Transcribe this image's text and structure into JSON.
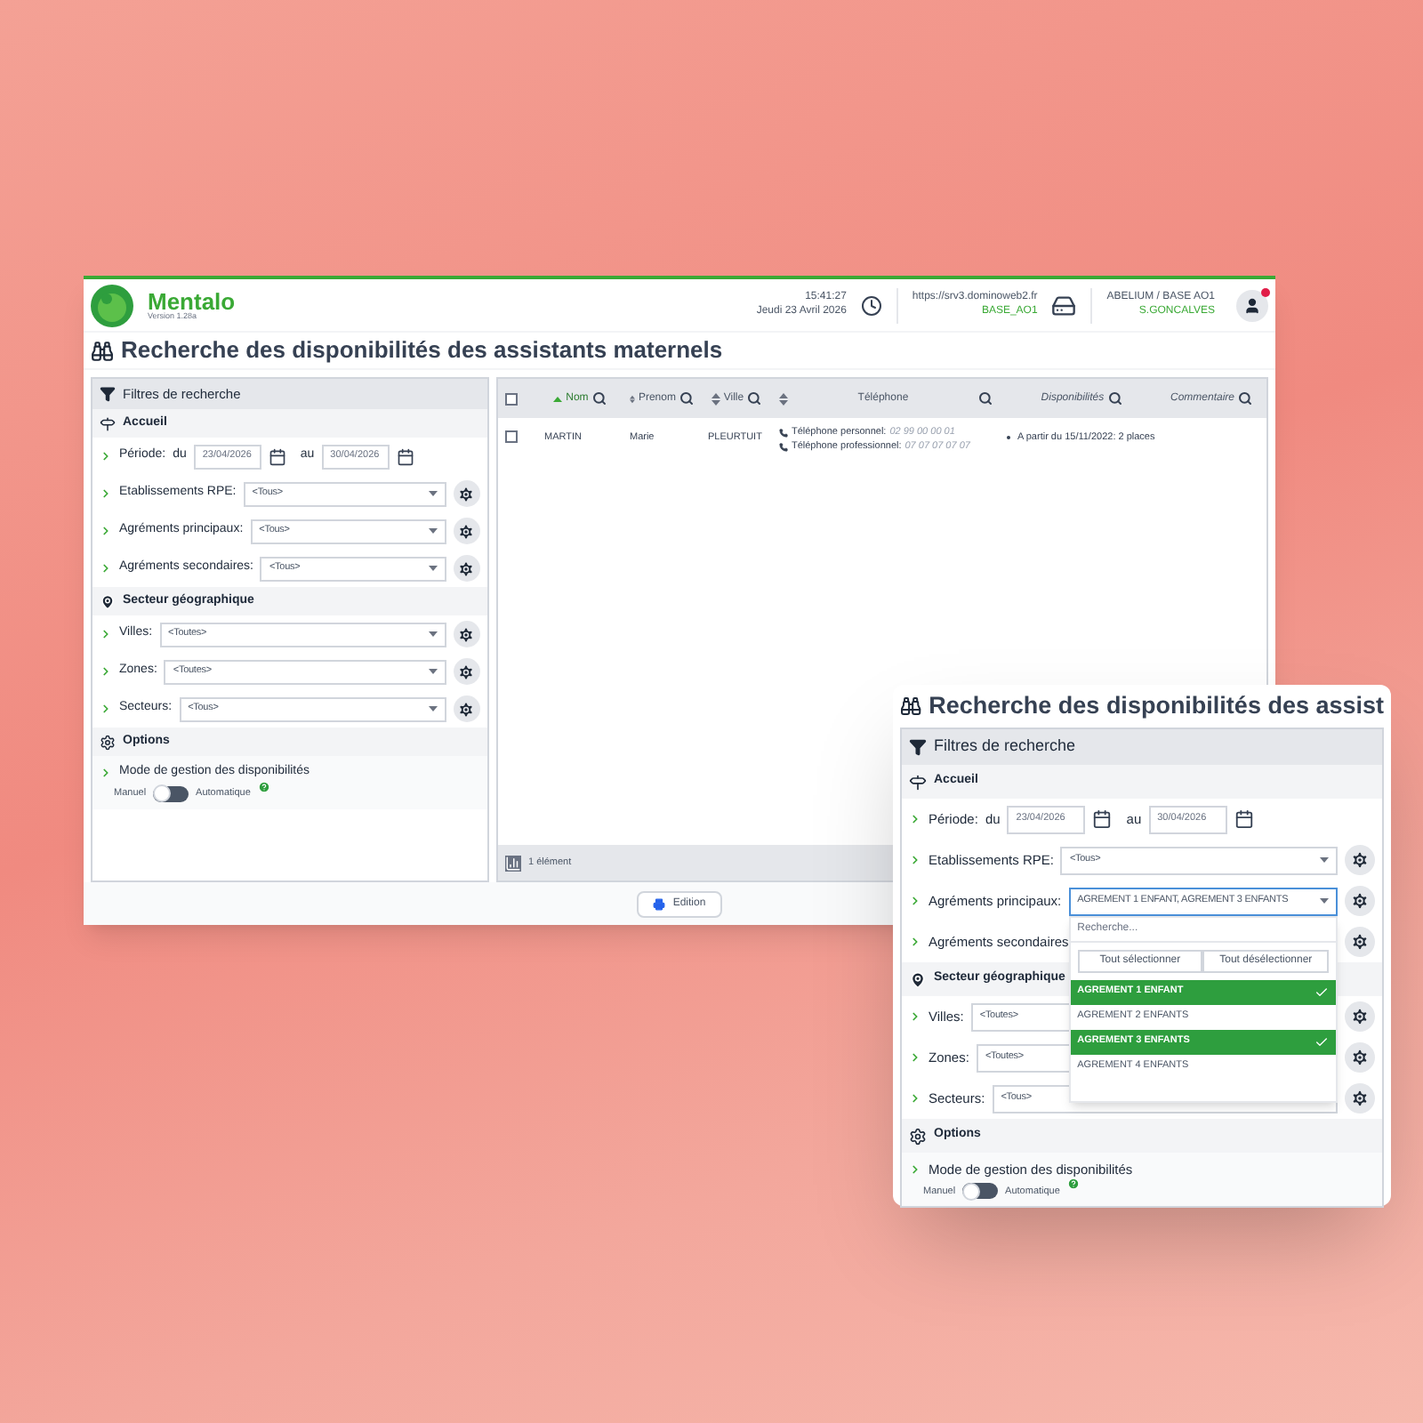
{
  "app": {
    "name": "Mentalo",
    "version": "Version 1.28a"
  },
  "header": {
    "time": "15:41:27",
    "date": "Jeudi 23 Avril 2026",
    "server_url": "https://srv3.dominoweb2.fr",
    "server_base": "BASE_AO1",
    "org": "ABELIUM / BASE AO1",
    "user": "S.GONCALVES",
    "notification": true
  },
  "page_title": "Recherche des disponibilités des assistants maternels",
  "filters": {
    "title": "Filtres de recherche",
    "sections": [
      {
        "kind": "accueil",
        "title": "Accueil",
        "rows": [
          {
            "kind": "period",
            "label": "Période:",
            "from_label": "du",
            "from": "23/04/2026",
            "to_label": "au",
            "to": "30/04/2026"
          },
          {
            "kind": "select",
            "label": "Etablissements RPE:",
            "value": "<Tous>"
          },
          {
            "kind": "select",
            "label": "Agréments principaux:",
            "value": "<Tous>",
            "open": false
          },
          {
            "kind": "select",
            "label": "Agréments secondaires:",
            "value": "<Tous>"
          }
        ]
      },
      {
        "kind": "geo",
        "title": "Secteur géographique",
        "rows": [
          {
            "kind": "select",
            "label": "Villes:",
            "value": "<Toutes>"
          },
          {
            "kind": "select",
            "label": "Zones:",
            "value": "<Toutes>"
          },
          {
            "kind": "select",
            "label": "Secteurs:",
            "value": "<Tous>"
          }
        ]
      },
      {
        "kind": "options",
        "title": "Options",
        "rows": [
          {
            "kind": "toggle",
            "label": "Mode de gestion des disponibilités",
            "off_label": "Manuel",
            "on_label": "Automatique",
            "on": false
          }
        ]
      }
    ]
  },
  "table": {
    "all_selected": false,
    "columns": [
      {
        "label": "Nom",
        "sortable": true,
        "sorted": true
      },
      {
        "label": "Prenom",
        "sortable": true,
        "sorted": false
      },
      {
        "label": "Ville",
        "sortable": true,
        "sorted": false
      },
      {
        "label": "Téléphone",
        "sortable": true,
        "sorted": false
      },
      {
        "label": "Disponibilités",
        "sortable": false,
        "sorted": false
      },
      {
        "label": "Commentaire",
        "sortable": false,
        "sorted": false
      }
    ],
    "rows": [
      {
        "selected": false,
        "nom": "MARTIN",
        "prenom": "Marie",
        "ville": "PLEURTUIT",
        "phones": [
          {
            "label": "Téléphone personnel:",
            "value": "02 99 00 00 01"
          },
          {
            "label": "Téléphone professionnel:",
            "value": "07 07 07 07 07"
          }
        ],
        "dispos": [
          "A partir du 15/11/2022: 2 places"
        ]
      }
    ],
    "count": "1 élément"
  },
  "edit_button": "Edition",
  "zoom_panel": {
    "title": "Recherche des disponibilités des assist",
    "filters": {
      "title": "Filtres de recherche",
      "sections": [
        {
          "kind": "accueil",
          "title": "Accueil",
          "rows": [
            {
              "kind": "period",
              "label": "Période:",
              "from_label": "du",
              "from": "23/04/2026",
              "to_label": "au",
              "to": "30/04/2026"
            },
            {
              "kind": "select",
              "label": "Etablissements RPE:",
              "value": "<Tous>"
            },
            {
              "kind": "select",
              "label": "Agréments principaux:",
              "value": "AGREMENT 1 ENFANT, AGREMENT 3 ENFANTS",
              "open": true,
              "search_placeholder": "Recherche...",
              "select_all": "Tout sélectionner",
              "deselect_all": "Tout désélectionner",
              "options": [
                {
                  "label": "AGREMENT 1 ENFANT",
                  "selected": true
                },
                {
                  "label": "AGREMENT 2 ENFANTS",
                  "selected": false
                },
                {
                  "label": "AGREMENT 3 ENFANTS",
                  "selected": true
                },
                {
                  "label": "AGREMENT 4 ENFANTS",
                  "selected": false
                }
              ]
            },
            {
              "kind": "select",
              "label": "Agréments secondaires"
            }
          ]
        },
        {
          "kind": "geo",
          "title": "Secteur géographique",
          "rows": [
            {
              "kind": "select",
              "label": "Villes:",
              "value": "<Toutes>"
            },
            {
              "kind": "select",
              "label": "Zones:",
              "value": "<Toutes>"
            },
            {
              "kind": "select",
              "label": "Secteurs:",
              "value": "<Tous>"
            }
          ]
        },
        {
          "kind": "options",
          "title": "Options",
          "rows": [
            {
              "kind": "toggle",
              "label": "Mode de gestion des disponibilités",
              "off_label": "Manuel",
              "on_label": "Automatique",
              "on": false
            }
          ]
        }
      ]
    }
  }
}
